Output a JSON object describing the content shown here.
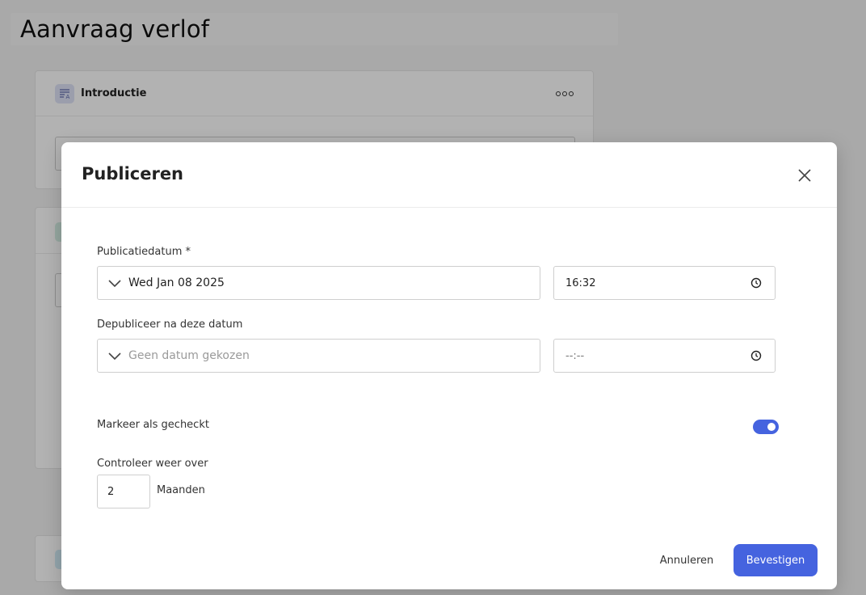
{
  "page": {
    "title": "Aanvraag verlof",
    "intro_card": {
      "title": "Introductie",
      "icon": "text-format-icon"
    }
  },
  "modal": {
    "title": "Publiceren",
    "publish_date": {
      "label": "Publicatiedatum *",
      "date_value": "Wed Jan 08 2025",
      "time_value": "16:32"
    },
    "unpublish_date": {
      "label": "Depubliceer na deze datum",
      "date_placeholder": "Geen datum gekozen",
      "time_placeholder": "--:--"
    },
    "mark_checked": {
      "label": "Markeer als gecheckt",
      "enabled": true
    },
    "recheck": {
      "label": "Controleer weer over",
      "value": "2",
      "unit": "Maanden"
    },
    "buttons": {
      "cancel": "Annuleren",
      "confirm": "Bevestigen"
    }
  },
  "colors": {
    "accent": "#4563df"
  }
}
